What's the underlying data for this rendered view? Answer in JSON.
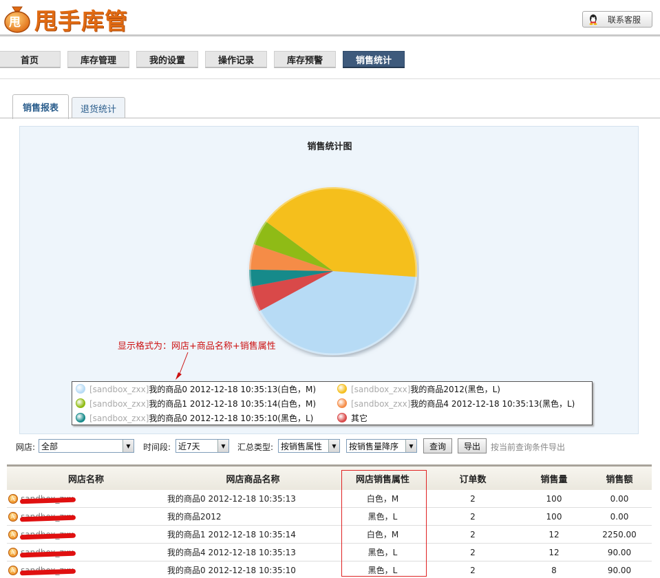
{
  "header": {
    "logo_badge": "甩",
    "logo_text": "甩手库管",
    "support_label": "联系客服"
  },
  "nav": {
    "items": [
      "首页",
      "库存管理",
      "我的设置",
      "操作记录",
      "库存预警",
      "销售统计"
    ],
    "active": "销售统计"
  },
  "tabs": {
    "items": [
      "销售报表",
      "退货统计"
    ],
    "active": "销售报表"
  },
  "chart_data": {
    "type": "pie",
    "title": "销售统计图",
    "series": [
      {
        "name": "[sandbox_zxx]我的商品0 2012-12-18 10:35:13(白色，M)",
        "value": 100,
        "color": "#b7dbf5"
      },
      {
        "name": "[sandbox_zxx]我的商品2012(黑色，L)",
        "value": 100,
        "color": "#f5bf1e"
      },
      {
        "name": "[sandbox_zxx]我的商品1 2012-12-18 10:35:14(白色，M)",
        "value": 12,
        "color": "#8fbb12"
      },
      {
        "name": "[sandbox_zxx]我的商品4 2012-12-18 10:35:13(黑色，L)",
        "value": 12,
        "color": "#f58c47"
      },
      {
        "name": "[sandbox_zxx]我的商品0 2012-12-18 10:35:10(黑色，L)",
        "value": 8,
        "color": "#168a8a"
      },
      {
        "name": "其它",
        "value": 12,
        "color": "#d94848"
      }
    ],
    "legend_placement": "bottom"
  },
  "chart": {
    "annotation": "显示格式为：网店+商品名称+销售属性",
    "legend": [
      {
        "shop": "[sandbox_zxx]",
        "text": "我的商品0 2012-12-18 10:35:13(白色，M)",
        "color": "#b7dbf5"
      },
      {
        "shop": "[sandbox_zxx]",
        "text": "我的商品2012(黑色，L)",
        "color": "#f5bf1e"
      },
      {
        "shop": "[sandbox_zxx]",
        "text": "我的商品1 2012-12-18 10:35:14(白色，M)",
        "color": "#8fbb12"
      },
      {
        "shop": "[sandbox_zxx]",
        "text": "我的商品4 2012-12-18 10:35:13(黑色，L)",
        "color": "#f58c47"
      },
      {
        "shop": "[sandbox_zxx]",
        "text": "我的商品0 2012-12-18 10:35:10(黑色，L)",
        "color": "#168a8a"
      },
      {
        "shop": "",
        "text": "其它",
        "color": "#d94848"
      }
    ]
  },
  "filters": {
    "shop_label": "网店:",
    "shop_value": "全部",
    "period_label": "时间段:",
    "period_value": "近7天",
    "summary_label": "汇总类型:",
    "summary_value": "按销售属性",
    "sort_value": "按销售量降序",
    "query_label": "查询",
    "export_label": "导出",
    "export_hint": "按当前查询条件导出"
  },
  "table": {
    "headers": [
      "网店名称",
      "网店商品名称",
      "网店销售属性",
      "订单数",
      "销售量",
      "销售额"
    ],
    "rows": [
      {
        "shop": "sandbox_zxx",
        "name": "我的商品0 2012-12-18 10:35:13",
        "attr": "白色，M",
        "orders": "2",
        "qty": "100",
        "amount": "0.00"
      },
      {
        "shop": "sandbox_zxx",
        "name": "我的商品2012",
        "attr": "黑色，L",
        "orders": "2",
        "qty": "100",
        "amount": "0.00"
      },
      {
        "shop": "sandbox_zxx",
        "name": "我的商品1 2012-12-18 10:35:14",
        "attr": "白色，M",
        "orders": "2",
        "qty": "12",
        "amount": "2250.00"
      },
      {
        "shop": "sandbox_zxx",
        "name": "我的商品4 2012-12-18 10:35:13",
        "attr": "黑色，L",
        "orders": "2",
        "qty": "12",
        "amount": "90.00"
      },
      {
        "shop": "sandbox_zxx",
        "name": "我的商品0 2012-12-18 10:35:10",
        "attr": "黑色，L",
        "orders": "2",
        "qty": "8",
        "amount": "90.00"
      }
    ]
  }
}
